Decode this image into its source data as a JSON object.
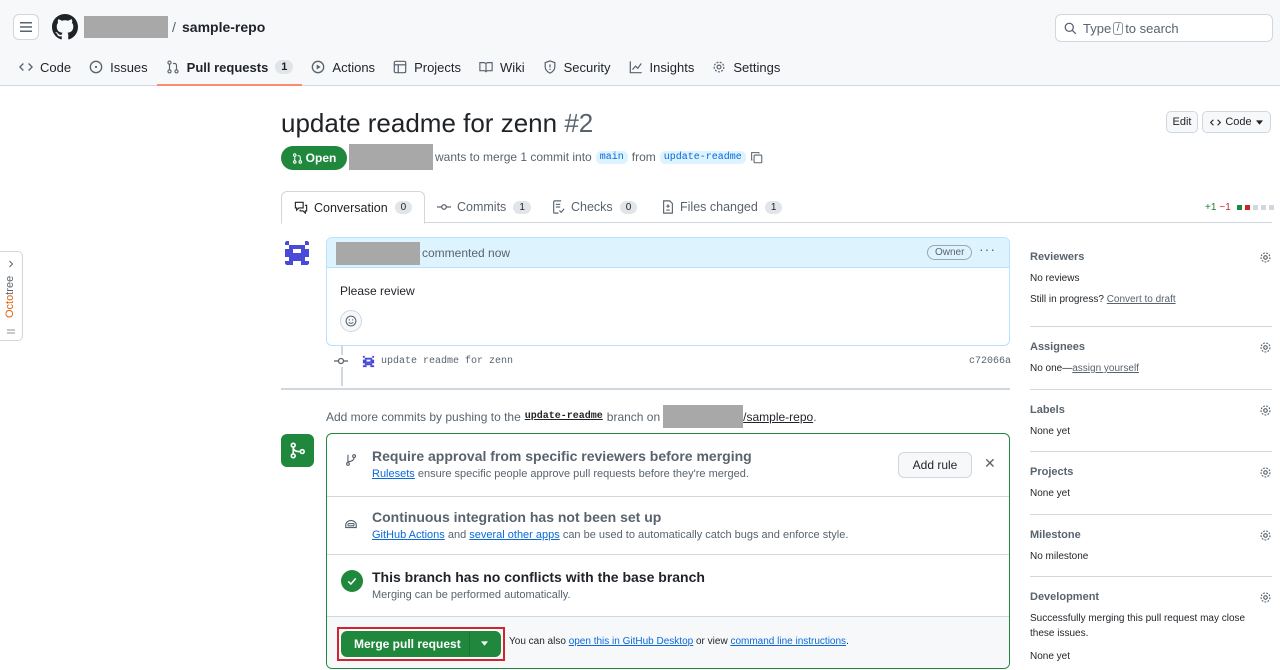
{
  "header": {
    "repo_separator": "/",
    "repo_name": "sample-repo",
    "search": {
      "prefix": "Type",
      "key": "/",
      "suffix": "to search"
    }
  },
  "repo_tabs": [
    {
      "label": "Code",
      "icon": "code-icon"
    },
    {
      "label": "Issues",
      "icon": "issue-opened-icon"
    },
    {
      "label": "Pull requests",
      "icon": "git-pull-request-icon",
      "count": "1",
      "active": true
    },
    {
      "label": "Actions",
      "icon": "play-icon"
    },
    {
      "label": "Projects",
      "icon": "table-icon"
    },
    {
      "label": "Wiki",
      "icon": "book-icon"
    },
    {
      "label": "Security",
      "icon": "shield-icon"
    },
    {
      "label": "Insights",
      "icon": "graph-icon"
    },
    {
      "label": "Settings",
      "icon": "gear-icon"
    }
  ],
  "octotree": {
    "label_prefix": "Octo",
    "label_suffix": "tree"
  },
  "pr": {
    "title": "update readme for zenn",
    "number": "#2",
    "edit_label": "Edit",
    "code_label": "Code",
    "state": "Open",
    "meta_text": "wants to merge 1 commit into",
    "base_branch": "main",
    "from_word": "from",
    "head_branch": "update-readme"
  },
  "pr_tabs": [
    {
      "label": "Conversation",
      "count": "0",
      "icon": "comment-discussion-icon",
      "active": true
    },
    {
      "label": "Commits",
      "count": "1",
      "icon": "git-commit-icon"
    },
    {
      "label": "Checks",
      "count": "0",
      "icon": "checklist-icon"
    },
    {
      "label": "Files changed",
      "count": "1",
      "icon": "file-diff-icon"
    }
  ],
  "diffstat": {
    "additions": "+1",
    "deletions": "−1"
  },
  "comment": {
    "time_text": "commented now",
    "role_badge": "Owner",
    "body": "Please review"
  },
  "commit": {
    "message": "update readme for zenn",
    "sha": "c72066a"
  },
  "push_hint": {
    "prefix": "Add more commits by pushing to the",
    "branch": "update-readme",
    "middle": "branch on",
    "repo": "/sample-repo",
    "suffix": "."
  },
  "merge": {
    "rule_title": "Require approval from specific reviewers before merging",
    "rule_link": "Rulesets",
    "rule_desc": "ensure specific people approve pull requests before they're merged.",
    "add_rule_label": "Add rule",
    "ci_title": "Continuous integration has not been set up",
    "ci_link1": "GitHub Actions",
    "ci_and": "and",
    "ci_link2": "several other apps",
    "ci_desc": "can be used to automatically catch bugs and enforce style.",
    "conflict_title": "This branch has no conflicts with the base branch",
    "conflict_desc": "Merging can be performed automatically.",
    "merge_button": "Merge pull request",
    "alt_prefix": "You can also",
    "alt_link1": "open this in GitHub Desktop",
    "alt_middle": "or view",
    "alt_link2": "command line instructions",
    "alt_suffix": "."
  },
  "sidebar": {
    "reviewers": {
      "title": "Reviewers",
      "line1": "No reviews",
      "line2_prefix": "Still in progress?",
      "line2_link": "Convert to draft"
    },
    "assignees": {
      "title": "Assignees",
      "prefix": "No one—",
      "link": "assign yourself"
    },
    "labels": {
      "title": "Labels",
      "text": "None yet"
    },
    "projects": {
      "title": "Projects",
      "text": "None yet"
    },
    "milestone": {
      "title": "Milestone",
      "text": "No milestone"
    },
    "development": {
      "title": "Development",
      "line1": "Successfully merging this pull request may close",
      "line2": "these issues.",
      "line3": "None yet"
    }
  },
  "colors": {
    "accent": "#1f883d",
    "link": "#0969da",
    "tab_underline": "#fd8c73",
    "highlight_border": "#d1242f"
  }
}
